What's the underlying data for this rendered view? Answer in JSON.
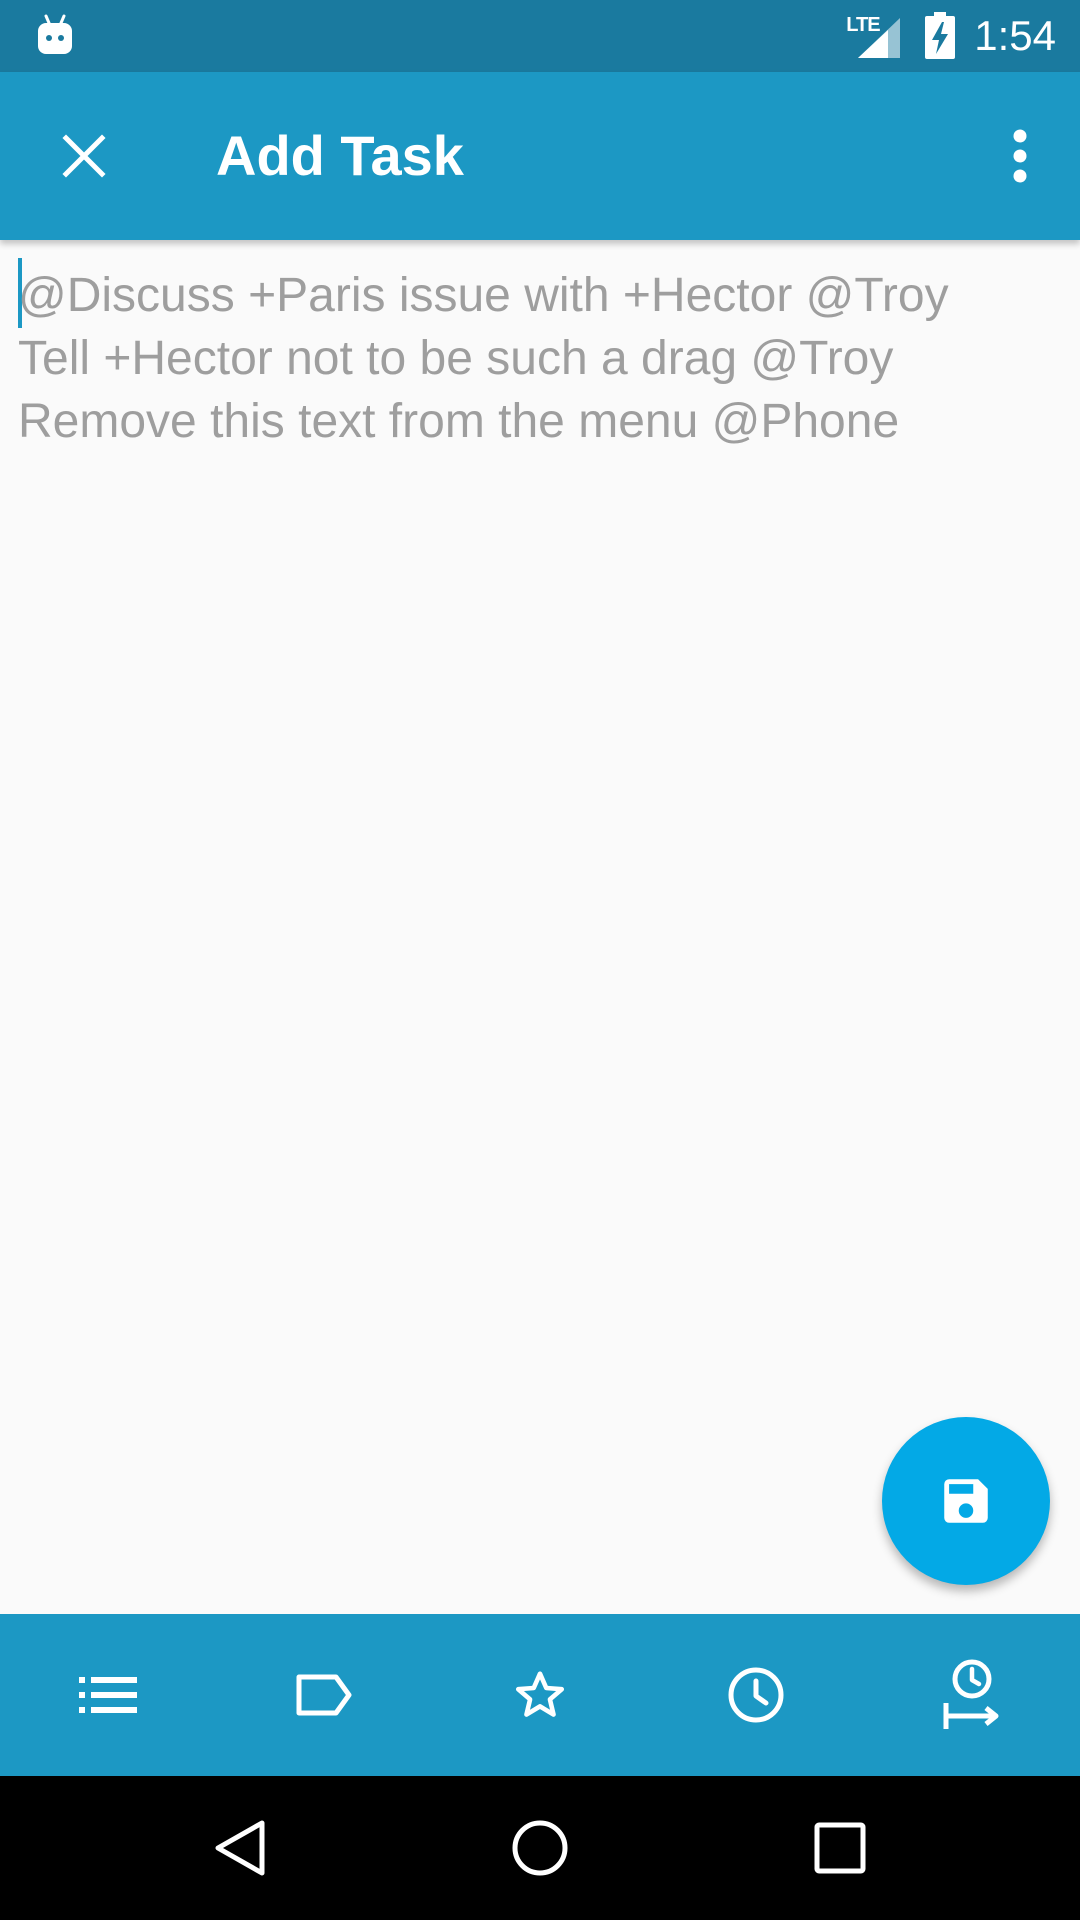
{
  "status_bar": {
    "network": "LTE",
    "time": "1:54"
  },
  "toolbar": {
    "title": "Add Task",
    "close_icon": "close-icon",
    "menu_icon": "more-vert-icon"
  },
  "editor": {
    "placeholder_lines": [
      "@Discuss +Paris issue with +Hector @Troy",
      "Tell +Hector not to be such a drag @Troy",
      "Remove this text from the menu @Phone"
    ]
  },
  "fab": {
    "icon": "save-icon"
  },
  "bottom_toolbar": {
    "icons": [
      "list-icon",
      "tag-icon",
      "star-icon",
      "clock-icon",
      "defer-threshold-icon"
    ]
  },
  "colors": {
    "status_bar": "#1a7a9f",
    "toolbar": "#1c98c4",
    "fab": "#03a9e6",
    "placeholder_text": "#9e9e9e",
    "background": "#fafafa"
  }
}
